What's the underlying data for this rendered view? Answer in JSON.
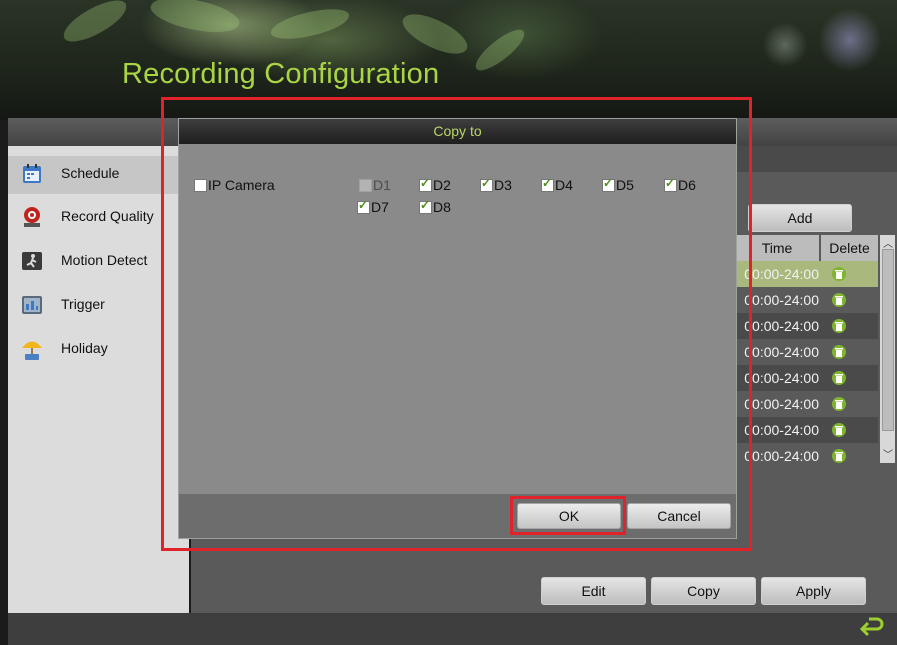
{
  "window": {
    "title": "Recording Configuration"
  },
  "sidebar": {
    "items": [
      {
        "label": "Schedule",
        "icon": "calendar-icon",
        "active": true
      },
      {
        "label": "Record Quality",
        "icon": "record-quality-icon",
        "active": false
      },
      {
        "label": "Motion Detect",
        "icon": "running-person-icon",
        "active": false
      },
      {
        "label": "Trigger",
        "icon": "trigger-icon",
        "active": false
      },
      {
        "label": "Holiday",
        "icon": "umbrella-icon",
        "active": false
      }
    ]
  },
  "schedule_panel": {
    "add_label": "Add",
    "columns": {
      "time": "Time",
      "delete": "Delete"
    },
    "rows": [
      {
        "time": "00:00-24:00",
        "selected": true
      },
      {
        "time": "00:00-24:00"
      },
      {
        "time": "00:00-24:00"
      },
      {
        "time": "00:00-24:00"
      },
      {
        "time": "00:00-24:00"
      },
      {
        "time": "00:00-24:00"
      },
      {
        "time": "00:00-24:00"
      },
      {
        "time": "00:00-24:00"
      }
    ]
  },
  "footer": {
    "edit_label": "Edit",
    "copy_label": "Copy",
    "apply_label": "Apply"
  },
  "dialog": {
    "title": "Copy to",
    "ip_camera_label": "IP Camera",
    "channels": [
      {
        "label": "D1",
        "checked": false,
        "disabled": true
      },
      {
        "label": "D2",
        "checked": true
      },
      {
        "label": "D3",
        "checked": true
      },
      {
        "label": "D4",
        "checked": true
      },
      {
        "label": "D5",
        "checked": true
      },
      {
        "label": "D6",
        "checked": true
      },
      {
        "label": "D7",
        "checked": true
      },
      {
        "label": "D8",
        "checked": true
      }
    ],
    "ok_label": "OK",
    "cancel_label": "Cancel"
  },
  "colors": {
    "accent_green": "#a9d545",
    "highlight_red": "#e0232b"
  }
}
